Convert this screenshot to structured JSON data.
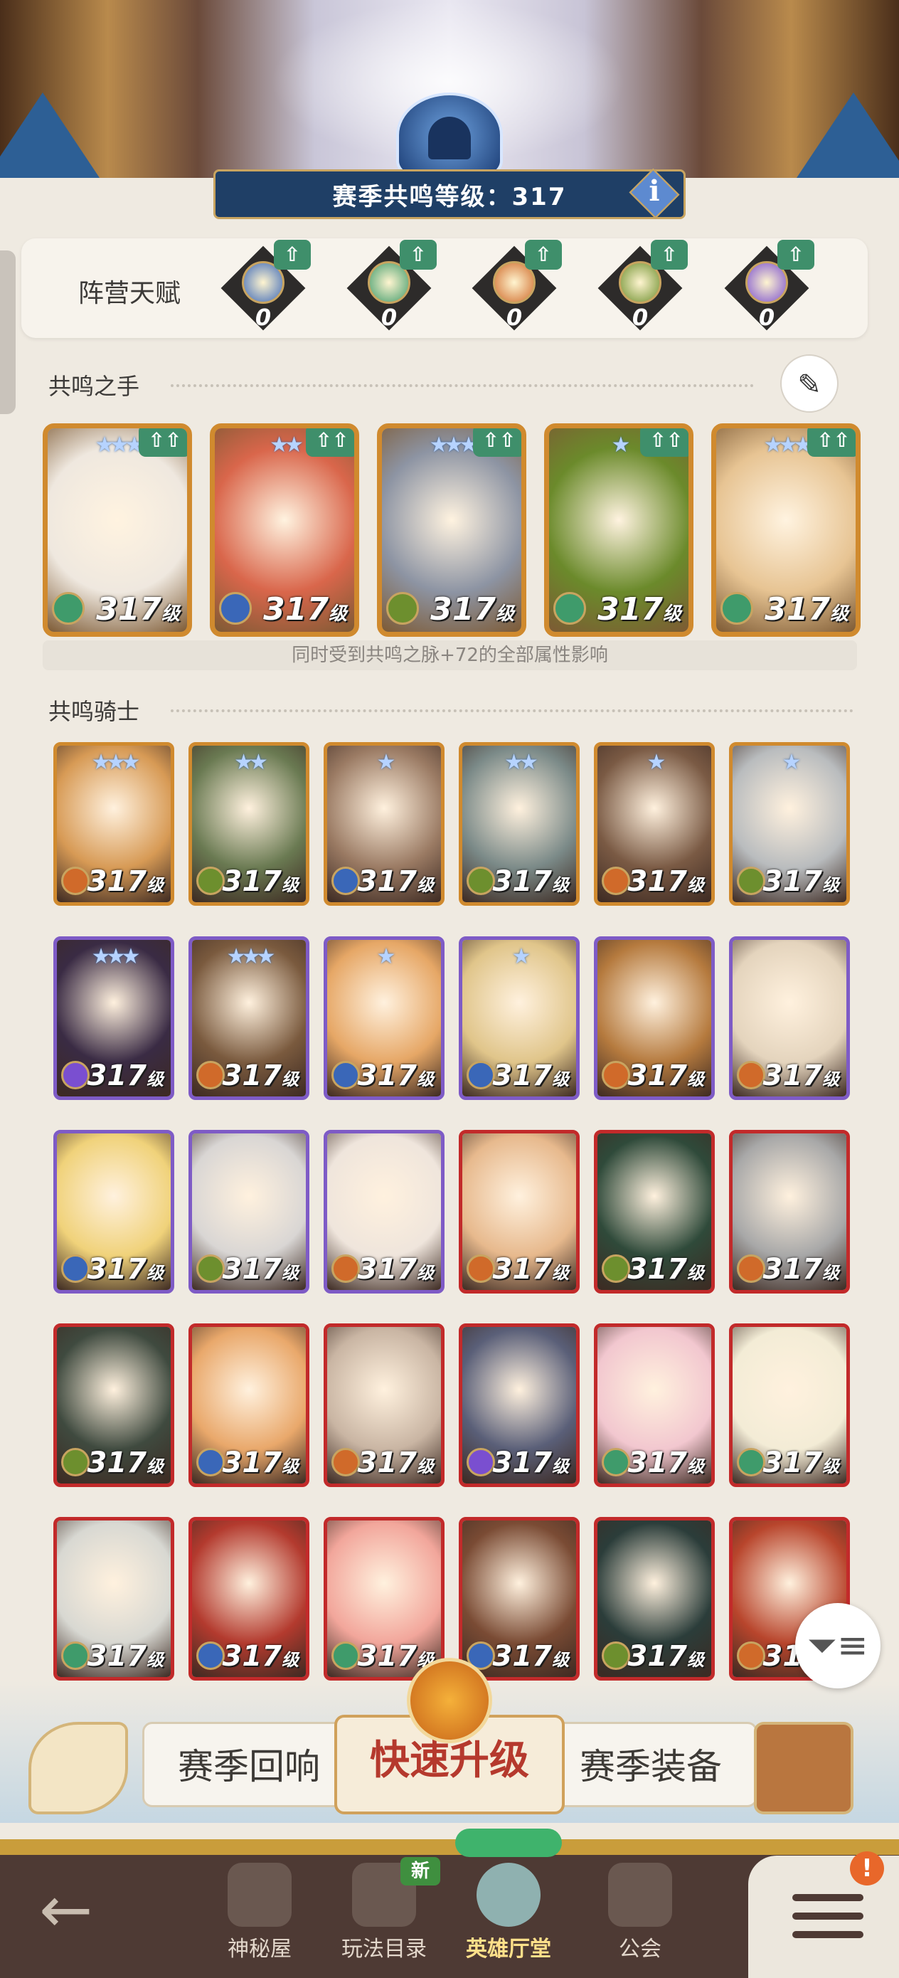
{
  "header": {
    "resonance_level": "赛季共鸣等级：317",
    "info_label": "i"
  },
  "faction_talent": {
    "label": "阵营天赋",
    "upgrade_symbol": "⇧",
    "factions": [
      {
        "icon": "lightbearer-icon",
        "count": "0",
        "color": "#3a67b8"
      },
      {
        "icon": "wilder-icon",
        "count": "0",
        "color": "#3f9b6b"
      },
      {
        "icon": "maulers-icon",
        "count": "0",
        "color": "#d06a2a"
      },
      {
        "icon": "graveborn-icon",
        "count": "0",
        "color": "#6d8f2e"
      },
      {
        "icon": "celestial-icon",
        "count": "0",
        "color": "#7a4fd0"
      }
    ]
  },
  "hands": {
    "title": "共鸣之手",
    "note": "同时受到共鸣之脉+72的全部属性影响",
    "up_label": "⇧⇧",
    "level_suffix": "级",
    "heroes": [
      {
        "stars": "★★★",
        "level": "317",
        "faction_color": "#3f9b6b",
        "tint": "#efe8df"
      },
      {
        "stars": "★★",
        "level": "317",
        "faction_color": "#3a67b8",
        "tint": "#d9664b"
      },
      {
        "stars": "★★★",
        "level": "317",
        "faction_color": "#6d8f2e",
        "tint": "#8d94a3"
      },
      {
        "stars": "★",
        "level": "317",
        "faction_color": "#3f9b6b",
        "tint": "#6b8a2b"
      },
      {
        "stars": "★★★",
        "level": "317",
        "faction_color": "#3f9b6b",
        "tint": "#e7c493"
      }
    ]
  },
  "knights": {
    "title": "共鸣骑士",
    "level_suffix": "级",
    "heroes": [
      {
        "stars": "★★★",
        "level": "317",
        "frame": "orange",
        "faction_color": "#d06a2a",
        "tint": "#d79a55"
      },
      {
        "stars": "★★",
        "level": "317",
        "frame": "orange",
        "faction_color": "#6d8f2e",
        "tint": "#6a7a52"
      },
      {
        "stars": "★",
        "level": "317",
        "frame": "orange",
        "faction_color": "#3a67b8",
        "tint": "#9a7a63"
      },
      {
        "stars": "★★",
        "level": "317",
        "frame": "orange",
        "faction_color": "#6d8f2e",
        "tint": "#7b8a88"
      },
      {
        "stars": "★",
        "level": "317",
        "frame": "orange",
        "faction_color": "#d06a2a",
        "tint": "#7a5a44"
      },
      {
        "stars": "★",
        "level": "317",
        "frame": "orange",
        "faction_color": "#6d8f2e",
        "tint": "#b9bcbe"
      },
      {
        "stars": "★★★",
        "level": "317",
        "frame": "purple",
        "faction_color": "#7a4fd0",
        "tint": "#3a2b44"
      },
      {
        "stars": "★★★",
        "level": "317",
        "frame": "purple",
        "faction_color": "#d06a2a",
        "tint": "#7a5a3e"
      },
      {
        "stars": "★",
        "level": "317",
        "frame": "purple",
        "faction_color": "#3a67b8",
        "tint": "#e6a766"
      },
      {
        "stars": "★",
        "level": "317",
        "frame": "purple",
        "faction_color": "#3a67b8",
        "tint": "#e0c58a"
      },
      {
        "stars": "",
        "level": "317",
        "frame": "purple",
        "faction_color": "#d06a2a",
        "tint": "#b57a3e"
      },
      {
        "stars": "",
        "level": "317",
        "frame": "purple",
        "faction_color": "#d06a2a",
        "tint": "#e4d4bd"
      },
      {
        "stars": "",
        "level": "317",
        "frame": "purple",
        "faction_color": "#3a67b8",
        "tint": "#f0d27a"
      },
      {
        "stars": "",
        "level": "317",
        "frame": "purple",
        "faction_color": "#6d8f2e",
        "tint": "#d9d6d4"
      },
      {
        "stars": "",
        "level": "317",
        "frame": "purple",
        "faction_color": "#d06a2a",
        "tint": "#efe5dc"
      },
      {
        "stars": "",
        "level": "317",
        "frame": "red",
        "faction_color": "#d06a2a",
        "tint": "#e7b98d"
      },
      {
        "stars": "",
        "level": "317",
        "frame": "red",
        "faction_color": "#6d8f2e",
        "tint": "#2f4a3a"
      },
      {
        "stars": "",
        "level": "317",
        "frame": "red",
        "faction_color": "#d06a2a",
        "tint": "#a8a8a8"
      },
      {
        "stars": "",
        "level": "317",
        "frame": "red",
        "faction_color": "#6d8f2e",
        "tint": "#3f4a3f"
      },
      {
        "stars": "",
        "level": "317",
        "frame": "red",
        "faction_color": "#3a67b8",
        "tint": "#e9a86b"
      },
      {
        "stars": "",
        "level": "317",
        "frame": "red",
        "faction_color": "#d06a2a",
        "tint": "#c9b5a3"
      },
      {
        "stars": "",
        "level": "317",
        "frame": "red",
        "faction_color": "#7a4fd0",
        "tint": "#5a5f78"
      },
      {
        "stars": "",
        "level": "317",
        "frame": "red",
        "faction_color": "#3f9b6b",
        "tint": "#f2c7cf"
      },
      {
        "stars": "",
        "level": "317",
        "frame": "red",
        "faction_color": "#3f9b6b",
        "tint": "#f3ecd6"
      },
      {
        "stars": "",
        "level": "317",
        "frame": "red",
        "faction_color": "#3f9b6b",
        "tint": "#d8d8d2"
      },
      {
        "stars": "",
        "level": "317",
        "frame": "red",
        "faction_color": "#3a67b8",
        "tint": "#b33a2e"
      },
      {
        "stars": "",
        "level": "317",
        "frame": "red",
        "faction_color": "#3f9b6b",
        "tint": "#f2a69b"
      },
      {
        "stars": "",
        "level": "317",
        "frame": "red",
        "faction_color": "#3a67b8",
        "tint": "#7a4b34"
      },
      {
        "stars": "",
        "level": "317",
        "frame": "red",
        "faction_color": "#6d8f2e",
        "tint": "#2b3d3a"
      },
      {
        "stars": "",
        "level": "317",
        "frame": "red",
        "faction_color": "#d06a2a",
        "tint": "#b8452c"
      }
    ]
  },
  "actions": {
    "season_echo": "赛季回响",
    "quick_upgrade": "快速升级",
    "season_gear": "赛季装备"
  },
  "filter_icon": "filter-icon",
  "nav": {
    "back_symbol": "←",
    "new_badge": "新",
    "alert": "!",
    "items": [
      {
        "label": "神秘屋",
        "icon": "mystery-house-icon"
      },
      {
        "label": "玩法目录",
        "icon": "game-modes-icon"
      },
      {
        "label": "英雄厅堂",
        "icon": "hero-hall-icon"
      },
      {
        "label": "公会",
        "icon": "guild-icon"
      }
    ]
  }
}
